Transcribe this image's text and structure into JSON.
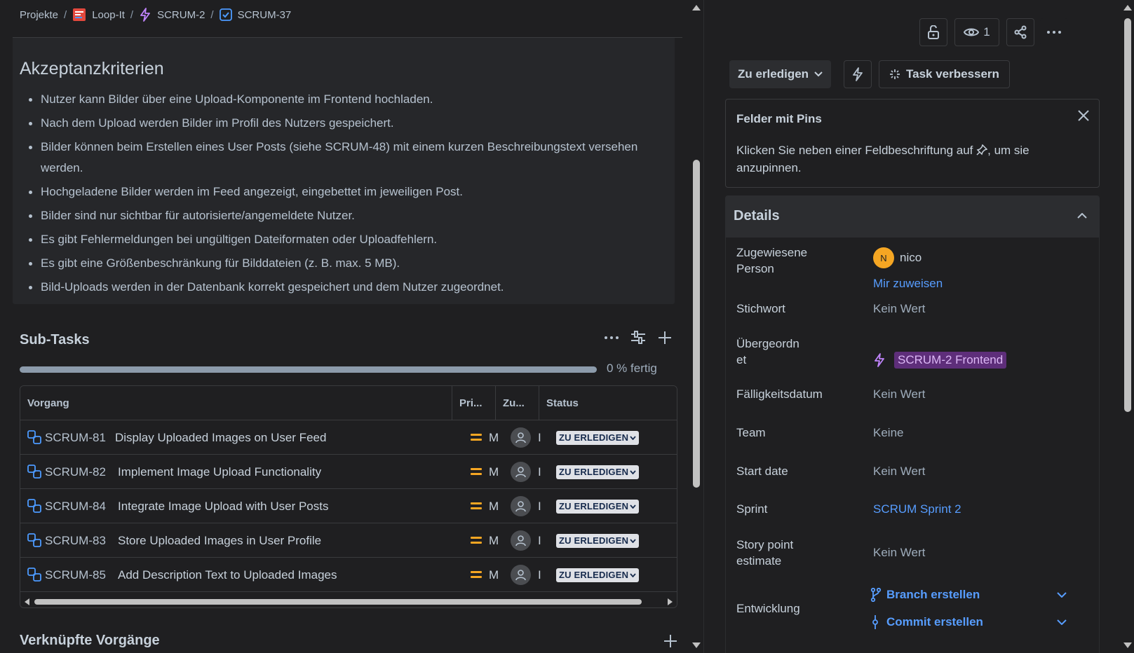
{
  "breadcrumb": {
    "items": [
      {
        "label": "Projekte",
        "icon": "none"
      },
      {
        "label": "Loop-It",
        "icon": "project-icon"
      },
      {
        "label": "SCRUM-2",
        "icon": "epic-lightning-icon"
      },
      {
        "label": "SCRUM-37",
        "icon": "task-checkbox-icon"
      }
    ],
    "separator": "/"
  },
  "description": {
    "heading": "Akzeptanzkriterien",
    "items": [
      "Nutzer kann Bilder über eine Upload-Komponente im Frontend hochladen.",
      "Nach dem Upload werden Bilder im Profil des Nutzers gespeichert.",
      "Bilder können beim Erstellen eines User Posts (siehe SCRUM-48) mit einem kurzen Beschreibungstext versehen werden.",
      "Hochgeladene Bilder werden im Feed angezeigt, eingebettet im jeweiligen Post.",
      "Bilder sind nur sichtbar für autorisierte/angemeldete Nutzer.",
      "Es gibt Fehlermeldungen bei ungültigen Dateiformaten oder Uploadfehlern.",
      "Es gibt eine Größenbeschränkung für Bilddateien (z. B. max. 5 MB).",
      "Bild-Uploads werden in der Datenbank korrekt gespeichert und dem Nutzer zugeordnet."
    ]
  },
  "subtasks": {
    "title": "Sub-Tasks",
    "progress_label": "0 % fertig",
    "progress_fraction": 0,
    "columns": [
      "Vorgang",
      "Pri...",
      "Zu...",
      "Status"
    ],
    "rows": [
      {
        "key": "SCRUM-81",
        "summary": "Display Uploaded Images on User Feed",
        "priority": "M",
        "assignee_trunc": "I",
        "status": "ZU ERLEDIGEN"
      },
      {
        "key": "SCRUM-82",
        "summary": "Implement Image Upload Functionality",
        "priority": "M",
        "assignee_trunc": "I",
        "status": "ZU ERLEDIGEN"
      },
      {
        "key": "SCRUM-84",
        "summary": "Integrate Image Upload with User Posts",
        "priority": "M",
        "assignee_trunc": "I",
        "status": "ZU ERLEDIGEN"
      },
      {
        "key": "SCRUM-83",
        "summary": "Store Uploaded Images in User Profile",
        "priority": "M",
        "assignee_trunc": "I",
        "status": "ZU ERLEDIGEN"
      },
      {
        "key": "SCRUM-85",
        "summary": "Add Description Text to Uploaded Images",
        "priority": "M",
        "assignee_trunc": "I",
        "status": "ZU ERLEDIGEN"
      }
    ]
  },
  "linked": {
    "title": "Verknüpfte Vorgänge"
  },
  "toolbar": {
    "watch_count": "1"
  },
  "actions": {
    "status_label": "Zu erledigen",
    "improve_label": "Task verbessern"
  },
  "pins": {
    "title": "Felder mit Pins",
    "text_before": "Klicken Sie neben einer Feldbeschriftung auf",
    "text_after": ", um sie anzupinnen."
  },
  "details": {
    "title": "Details",
    "assignee_label_1": "Zugewiesene",
    "assignee_label_2": "Person",
    "assignee_initial": "N",
    "assignee_name": "nico",
    "assign_me": "Mir zuweisen",
    "keyword_label": "Stichwort",
    "keyword_value": "Kein Wert",
    "parent_label_1": "Übergeordn",
    "parent_label_2": "et",
    "parent_value": "SCRUM-2 Frontend",
    "due_label": "Fälligkeitsdatum",
    "due_value": "Kein Wert",
    "team_label": "Team",
    "team_value": "Keine",
    "start_label": "Start date",
    "start_value": "Kein Wert",
    "sprint_label": "Sprint",
    "sprint_value": "SCRUM Sprint 2",
    "sp_label_1": "Story point",
    "sp_label_2": "estimate",
    "sp_value": "Kein Wert",
    "dev_label": "Entwicklung",
    "branch_label": "Branch erstellen",
    "commit_label": "Commit erstellen"
  },
  "colors": {
    "background": "#1f1f21",
    "link": "#579dff",
    "priority_medium": "#f5a623",
    "epic": "#c084fc"
  }
}
